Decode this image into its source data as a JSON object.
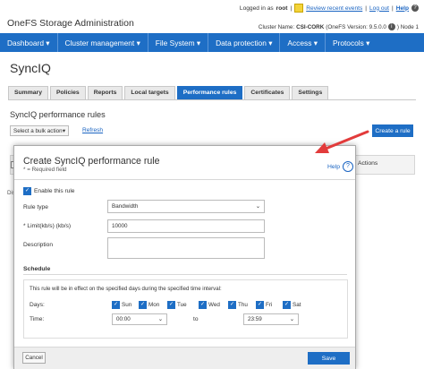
{
  "app": {
    "title": "OneFS Storage Administration",
    "logged_in_prefix": "Logged in as",
    "user": "root",
    "review_events": "Review recent events",
    "logout": "Log out",
    "help": "Help",
    "cluster_name_label": "Cluster Name:",
    "cluster_name": "CSI-CORK",
    "version": "(OneFS Version: 9.5.0.0",
    "node": ") Node 1"
  },
  "nav": [
    "Dashboard ▾",
    "Cluster management ▾",
    "File System ▾",
    "Data protection ▾",
    "Access ▾",
    "Protocols ▾"
  ],
  "page": {
    "title": "SyncIQ",
    "tabs": [
      "Summary",
      "Policies",
      "Reports",
      "Local targets",
      "Performance rules",
      "Certificates",
      "Settings"
    ],
    "active_tab": "Performance rules",
    "section_title": "SyncIQ performance rules",
    "bulk_action": "Select a bulk action",
    "refresh": "Refresh",
    "create_rule": "Create a rule",
    "actions_header": "Actions",
    "display_stub": "Dis"
  },
  "dialog": {
    "title": "Create SyncIQ performance rule",
    "required_note": "* = Required field",
    "help": "Help",
    "enable_label": "Enable this rule",
    "rule_type_label": "Rule type",
    "rule_type_value": "Bandwidth",
    "limit_label": "* Limit(kb/s) (kb/s)",
    "limit_value": "10000",
    "description_label": "Description",
    "description_value": "",
    "schedule_title": "Schedule",
    "schedule_note": "This rule will be in effect on the specified days during the specified time interval:",
    "days_label": "Days:",
    "days": [
      "Sun",
      "Mon",
      "Tue",
      "Wed",
      "Thu",
      "Fri",
      "Sat"
    ],
    "time_label": "Time:",
    "time_from": "00:00",
    "to_label": "to",
    "time_to": "23:59",
    "cancel": "Cancel",
    "save": "Save"
  },
  "colors": {
    "accent": "#1e6ec5",
    "arrow": "#e23b3b",
    "link": "#1a64c2"
  }
}
